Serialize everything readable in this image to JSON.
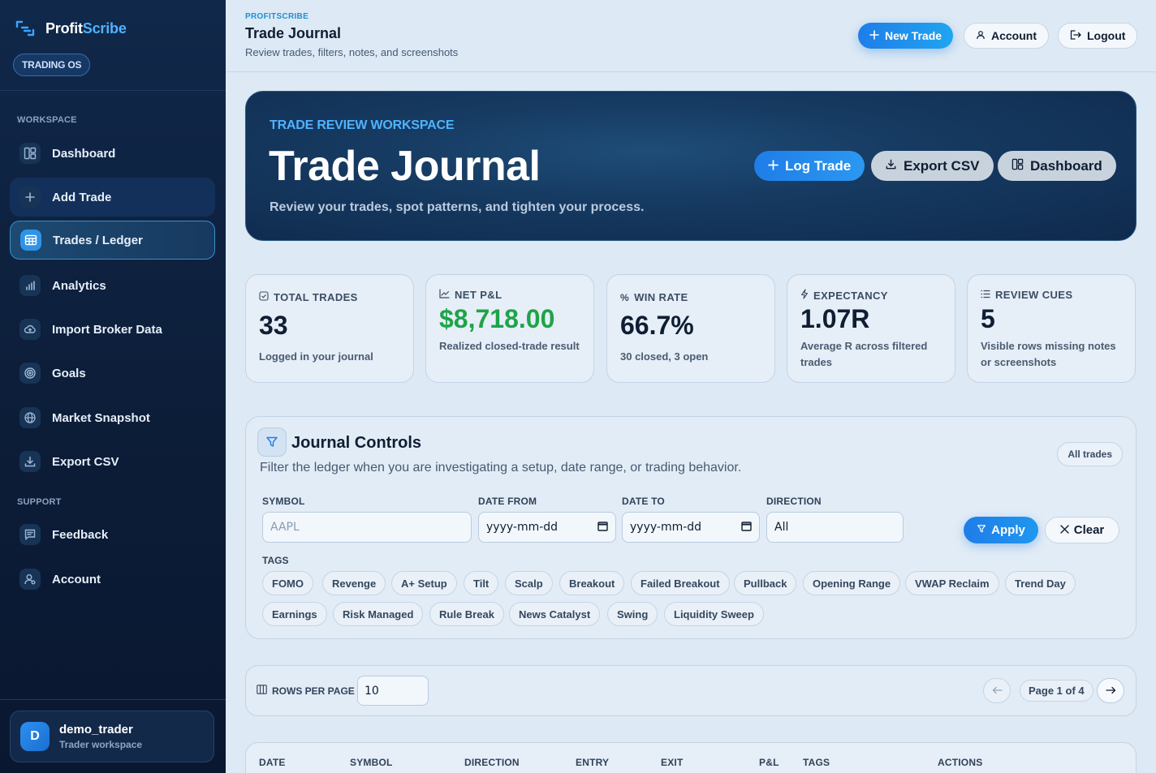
{
  "sidebar": {
    "brand_prefix": "Profit",
    "brand_accent": "Scribe",
    "badge": "TRADING OS",
    "workspace_label": "WORKSPACE",
    "support_label": "SUPPORT",
    "items": [
      {
        "label": "Dashboard",
        "icon": "layout-icon"
      },
      {
        "label": "Add Trade",
        "icon": "plus-icon"
      },
      {
        "label": "Trades / Ledger",
        "icon": "table-icon"
      },
      {
        "label": "Analytics",
        "icon": "bar-chart-icon"
      },
      {
        "label": "Import Broker Data",
        "icon": "cloud-upload-icon"
      },
      {
        "label": "Goals",
        "icon": "target-icon"
      },
      {
        "label": "Market Snapshot",
        "icon": "globe-icon"
      },
      {
        "label": "Export CSV",
        "icon": "download-icon"
      }
    ],
    "support_items": [
      {
        "label": "Feedback",
        "icon": "message-icon"
      },
      {
        "label": "Account",
        "icon": "user-icon"
      }
    ],
    "user": {
      "initial": "D",
      "name": "demo_trader",
      "sub": "Trader workspace"
    }
  },
  "topbar": {
    "eyebrow": "PROFITSCRIBE",
    "title": "Trade Journal",
    "subtitle": "Review trades, filters, notes, and screenshots",
    "new_trade": "New Trade",
    "account": "Account",
    "logout": "Logout"
  },
  "hero": {
    "eyebrow": "TRADE REVIEW WORKSPACE",
    "title": "Trade Journal",
    "subtitle": "Review your trades, spot patterns, and tighten your process.",
    "log_trade": "Log Trade",
    "export_csv": "Export CSV",
    "dashboard": "Dashboard"
  },
  "stats": [
    {
      "label": "TOTAL TRADES",
      "value": "33",
      "sub": "Logged in your journal"
    },
    {
      "label": "NET P&L",
      "value": "$8,718.00",
      "sub": "Realized closed-trade result"
    },
    {
      "label": "WIN RATE",
      "value": "66.7%",
      "sub": "30 closed, 3 open"
    },
    {
      "label": "EXPECTANCY",
      "value": "1.07R",
      "sub": "Average R across filtered trades"
    },
    {
      "label": "REVIEW CUES",
      "value": "5",
      "sub": "Visible rows missing notes or screenshots"
    }
  ],
  "colors": {
    "positive": "#1fa34a",
    "accent": "#1f7de8",
    "brand_accent": "#4fb3ff"
  },
  "controls": {
    "title": "Journal Controls",
    "subtitle": "Filter the ledger when you are investigating a setup, date range, or trading behavior.",
    "scope_pill": "All trades",
    "symbol_label": "SYMBOL",
    "symbol_placeholder": "AAPL",
    "date_from_label": "DATE FROM",
    "date_from_value": "yyyy-mm-dd",
    "date_to_label": "DATE TO",
    "date_to_value": "yyyy-mm-dd",
    "direction_label": "DIRECTION",
    "direction_value": "All",
    "apply": "Apply",
    "clear": "Clear",
    "tags_label": "TAGS",
    "tags": [
      "FOMO",
      "Revenge",
      "A+ Setup",
      "Tilt",
      "Scalp",
      "Breakout",
      "Failed Breakout",
      "Pullback",
      "Opening Range",
      "VWAP Reclaim",
      "Trend Day",
      "Earnings",
      "Risk Managed",
      "Rule Break",
      "News Catalyst",
      "Swing",
      "Liquidity Sweep"
    ]
  },
  "pagination": {
    "rows_label": "ROWS PER PAGE",
    "rows_value": "10",
    "page_text": "Page 1 of 4"
  },
  "table": {
    "headers": [
      "DATE",
      "SYMBOL",
      "DIRECTION",
      "ENTRY",
      "EXIT",
      "P&L",
      "TAGS",
      "ACTIONS"
    ]
  }
}
